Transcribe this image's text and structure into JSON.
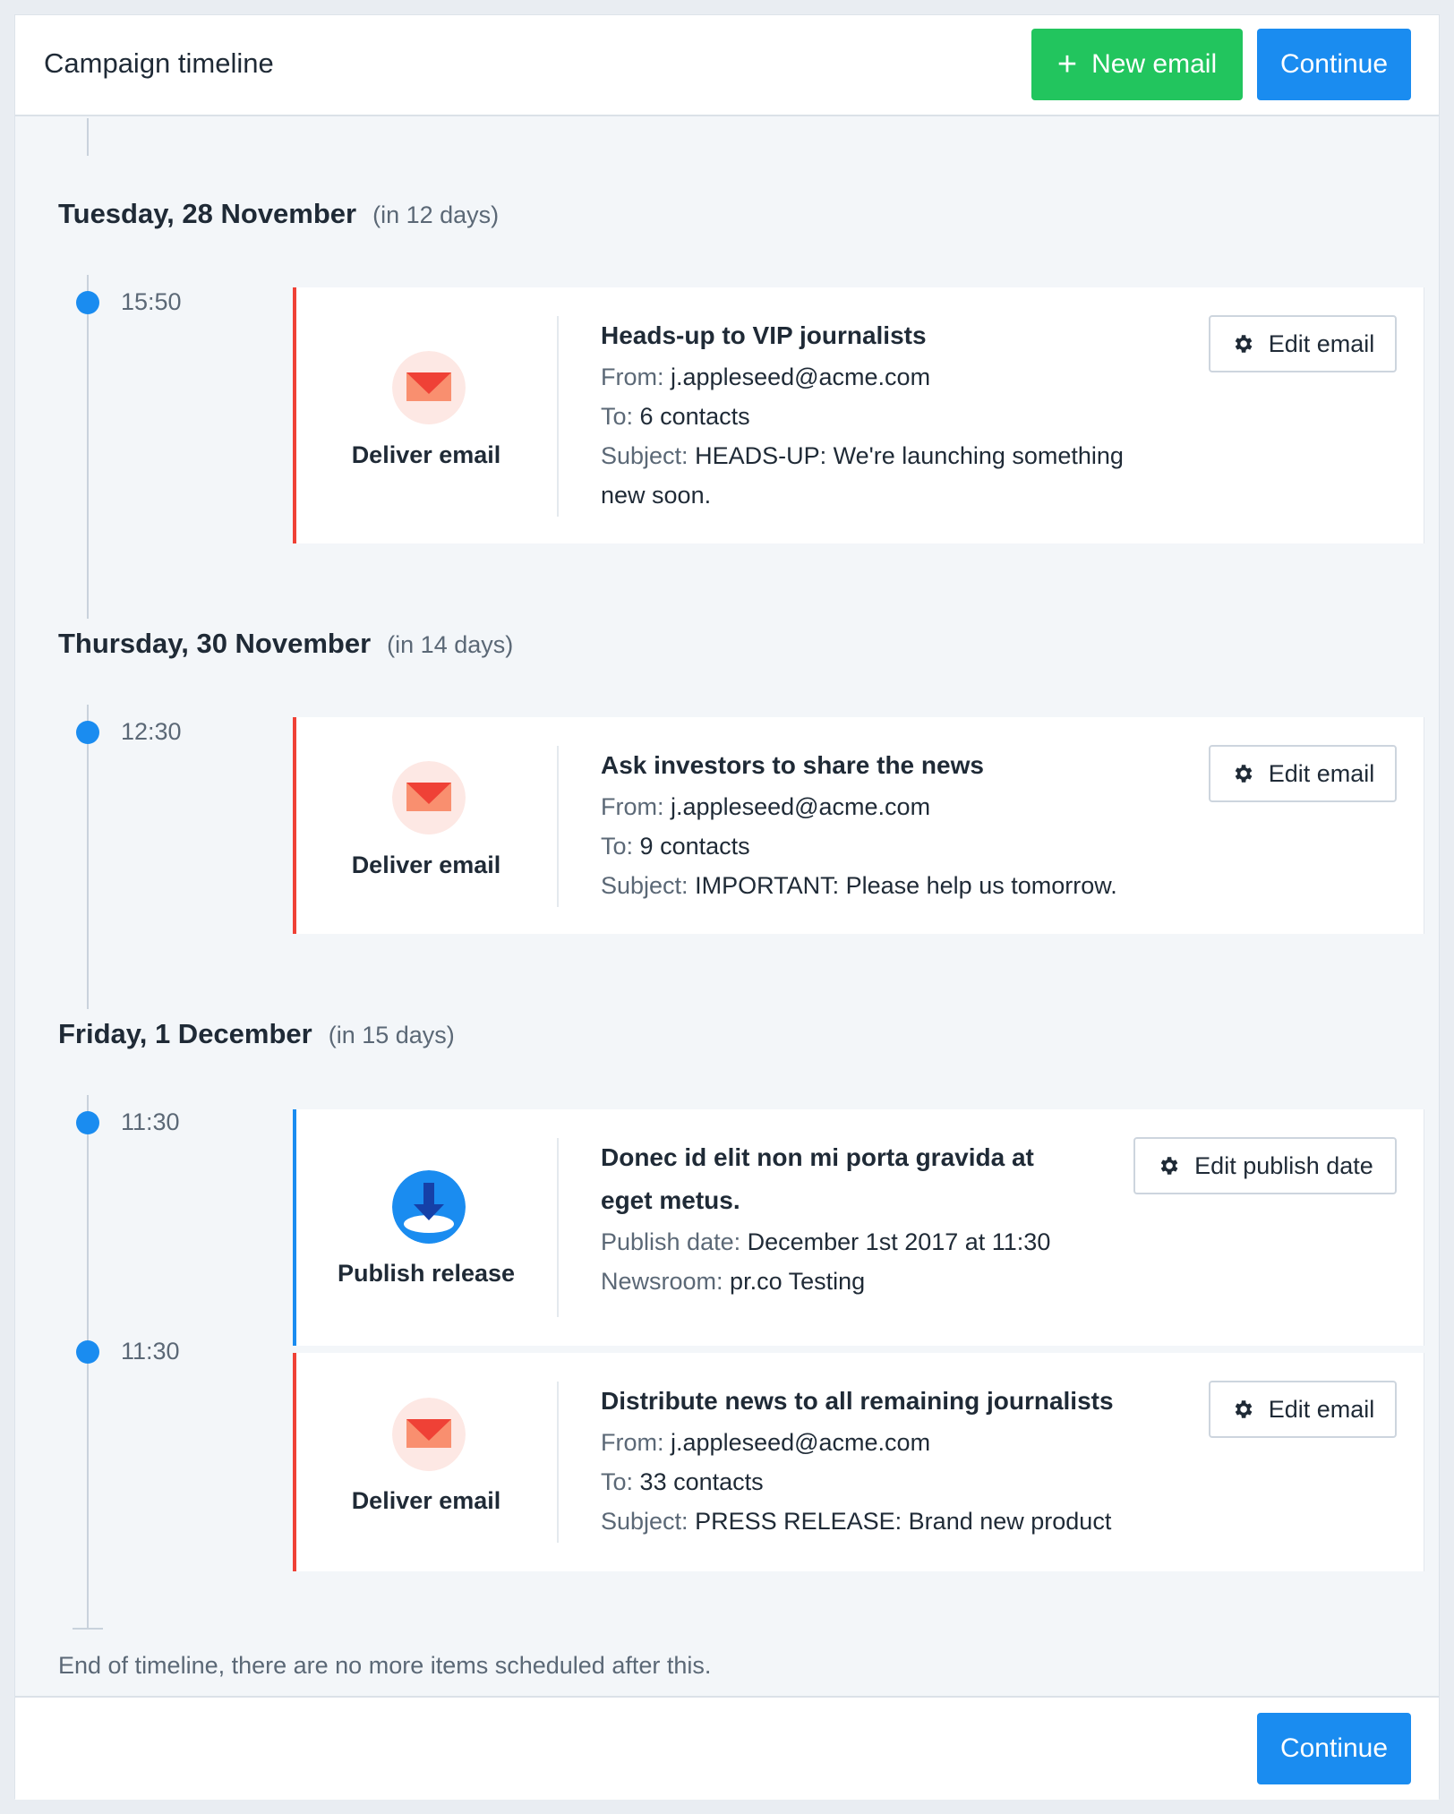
{
  "header": {
    "title": "Campaign timeline",
    "new_email_label": "New email",
    "continue_label": "Continue"
  },
  "days": [
    {
      "date": "Tuesday, 28 November",
      "relative": "(in 12 days)",
      "items": [
        {
          "time": "15:50",
          "type_label": "Deliver email",
          "title": "Heads-up to VIP journalists",
          "from_key": "From:",
          "from_value": "j.appleseed@acme.com",
          "to_key": "To:",
          "to_value": "6 contacts",
          "subject_key": "Subject:",
          "subject_value": "HEADS-UP: We're launching something",
          "subject_value_cont": "new soon.",
          "edit_label": "Edit email"
        }
      ]
    },
    {
      "date": "Thursday, 30 November",
      "relative": "(in 14 days)",
      "items": [
        {
          "time": "12:30",
          "type_label": "Deliver email",
          "title": "Ask investors to share the news",
          "from_key": "From:",
          "from_value": "j.appleseed@acme.com",
          "to_key": "To:",
          "to_value": "9 contacts",
          "subject_key": "Subject:",
          "subject_value": "IMPORTANT: Please help us tomorrow.",
          "edit_label": "Edit email"
        }
      ]
    },
    {
      "date": "Friday, 1 December",
      "relative": "(in 15 days)",
      "items": [
        {
          "time": "11:30",
          "type_label": "Publish release",
          "title_line1": "Donec id elit non mi porta gravida at",
          "title_line2": "eget metus.",
          "publish_key": "Publish date:",
          "publish_value": "December 1st 2017 at 11:30",
          "newsroom_key": "Newsroom:",
          "newsroom_value": "pr.co Testing",
          "edit_label": "Edit publish date"
        },
        {
          "time": "11:30",
          "type_label": "Deliver email",
          "title": "Distribute news to all remaining journalists",
          "from_key": "From:",
          "from_value": "j.appleseed@acme.com",
          "to_key": "To:",
          "to_value": "33 contacts",
          "subject_key": "Subject:",
          "subject_value": "PRESS RELEASE: Brand new product",
          "edit_label": "Edit email"
        }
      ]
    }
  ],
  "end_text": "End of timeline, there are no more items scheduled after this.",
  "footer": {
    "continue_label": "Continue"
  },
  "icons": {
    "deliver": "envelope-icon",
    "publish": "download-arrow-icon",
    "edit": "gear-icon",
    "new": "plus-icon"
  },
  "colors": {
    "accent_blue": "#1a8cf0",
    "accent_green": "#22c55e",
    "email_red": "#ef4136"
  }
}
